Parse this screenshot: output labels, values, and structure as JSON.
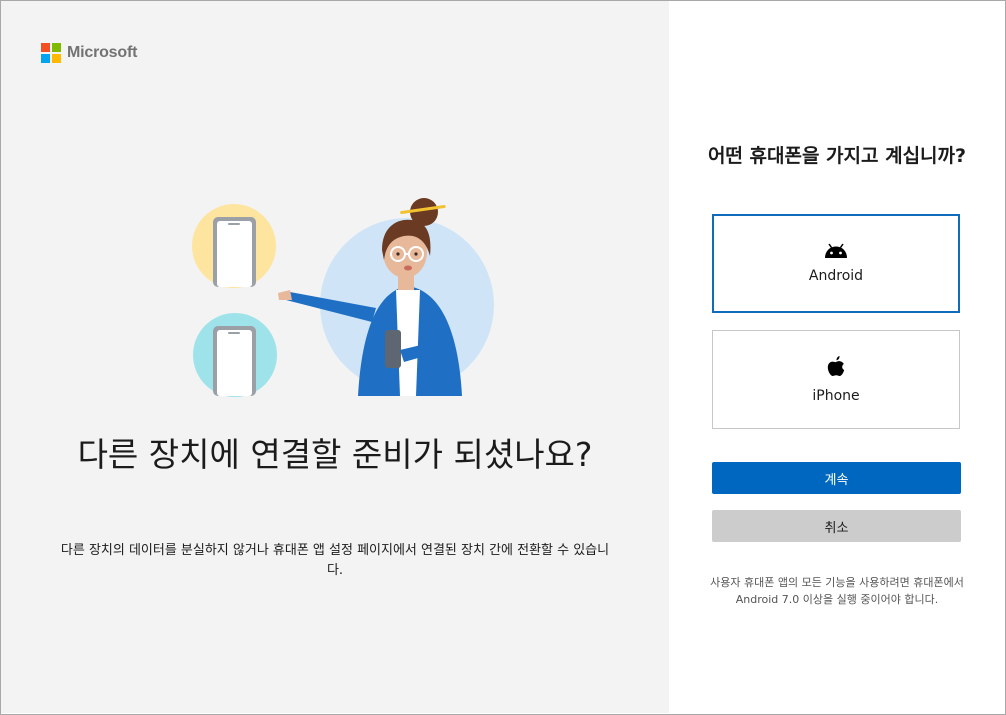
{
  "brand": {
    "name": "Microsoft",
    "logo_colors": [
      "#f25022",
      "#7fba00",
      "#00a4ef",
      "#ffb900"
    ]
  },
  "left": {
    "headline": "다른 장치에 연결할 준비가 되셨나요?",
    "subtext": "다른 장치의 데이터를 분실하지 않거나 휴대폰 앱 설정 페이지에서 연결된 장치 간에 전환할 수 있습니다."
  },
  "right": {
    "question": "어떤 휴대폰을 가지고 계십니까?",
    "options": [
      {
        "label": "Android",
        "icon": "android-icon",
        "selected": true
      },
      {
        "label": "iPhone",
        "icon": "apple-icon",
        "selected": false
      }
    ],
    "continue_label": "계속",
    "cancel_label": "취소",
    "note": "사용자 휴대폰 앱의 모든 기능을 사용하려면 휴대폰에서 Android 7.0 이상을 실행 중이어야 합니다."
  },
  "colors": {
    "accent": "#0067c0",
    "selected_border": "#0f6cbd",
    "left_bg": "#f3f3f3"
  }
}
